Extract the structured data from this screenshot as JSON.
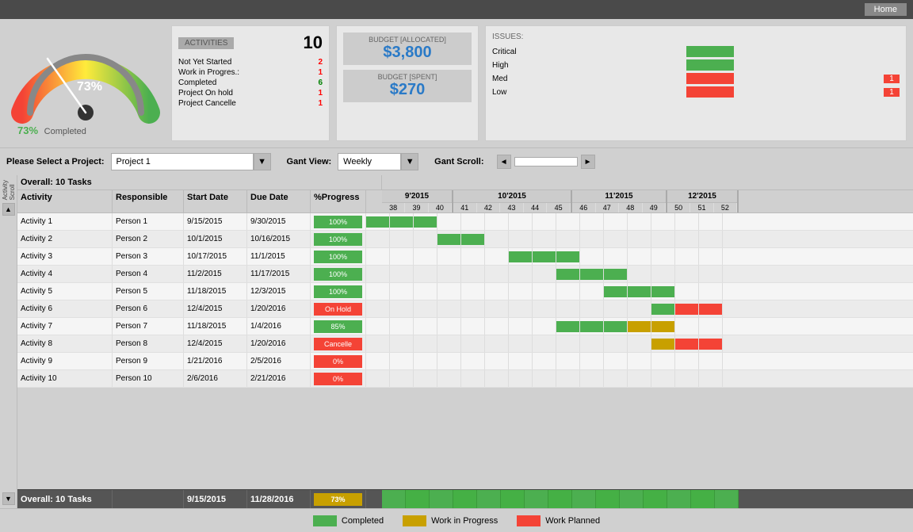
{
  "topbar": {
    "home_label": "Home"
  },
  "gauge": {
    "percent": 73,
    "label": "73%",
    "completed_text": "Completed"
  },
  "activities": {
    "title": "ACTIVITIES",
    "total": "10",
    "rows": [
      {
        "label": "Not Yet Started",
        "value": "2",
        "color": "red"
      },
      {
        "label": "Work in Progres.:",
        "value": "1",
        "color": "red"
      },
      {
        "label": "Completed",
        "value": "6",
        "color": "green"
      },
      {
        "label": "Project On hold",
        "value": "1",
        "color": "red"
      },
      {
        "label": "Project Cancelle",
        "value": "1",
        "color": "red"
      }
    ]
  },
  "budget": {
    "allocated_label": "BUDGET [ALLOCATED]",
    "allocated_value": "$3,800",
    "spent_label": "BUDGET [SPENT]",
    "spent_value": "$270"
  },
  "issues": {
    "title": "ISSUES:",
    "rows": [
      {
        "label": "Critical",
        "has_bar": true,
        "bar_color": "green",
        "count": ""
      },
      {
        "label": "High",
        "has_bar": true,
        "bar_color": "green",
        "count": ""
      },
      {
        "label": "Med",
        "has_bar": true,
        "bar_color": "red",
        "count": "1"
      },
      {
        "label": "Low",
        "has_bar": true,
        "bar_color": "red",
        "count": "1"
      }
    ]
  },
  "project_bar": {
    "label": "Please Select a Project:",
    "project_value": "Project 1",
    "gant_view_label": "Gant View:",
    "gant_view_value": "Weekly",
    "gant_scroll_label": "Gant Scroll:"
  },
  "gantt": {
    "overall_text": "Overall: 10 Tasks",
    "header": {
      "activity": "Activity",
      "responsible": "Responsible",
      "start_date": "Start Date",
      "due_date": "Due Date",
      "progress": "%Progress"
    },
    "months": [
      {
        "label": "9'2015",
        "weeks": [
          "38",
          "39",
          "40"
        ]
      },
      {
        "label": "10'2015",
        "weeks": [
          "41",
          "42",
          "43",
          "44",
          "45"
        ]
      },
      {
        "label": "11'2015",
        "weeks": [
          "46",
          "47",
          "48",
          "49"
        ]
      },
      {
        "label": "12'2015",
        "weeks": [
          "50",
          "51",
          "52"
        ]
      }
    ],
    "tasks": [
      {
        "activity": "Activity 1",
        "responsible": "Person 1",
        "start": "9/15/2015",
        "due": "9/30/2015",
        "progress": "100%",
        "prog_type": "100",
        "bars": [
          1,
          1,
          1,
          0,
          0,
          0,
          0,
          0,
          0,
          0,
          0,
          0,
          0,
          0,
          0
        ]
      },
      {
        "activity": "Activity 2",
        "responsible": "Person 2",
        "start": "10/1/2015",
        "due": "10/16/2015",
        "progress": "100%",
        "prog_type": "100",
        "bars": [
          0,
          0,
          0,
          1,
          1,
          0,
          0,
          0,
          0,
          0,
          0,
          0,
          0,
          0,
          0
        ]
      },
      {
        "activity": "Activity 3",
        "responsible": "Person 3",
        "start": "10/17/2015",
        "due": "11/1/2015",
        "progress": "100%",
        "prog_type": "100",
        "bars": [
          0,
          0,
          0,
          0,
          1,
          1,
          1,
          0,
          0,
          0,
          0,
          0,
          0,
          0,
          0
        ]
      },
      {
        "activity": "Activity 4",
        "responsible": "Person 4",
        "start": "11/2/2015",
        "due": "11/17/2015",
        "progress": "100%",
        "prog_type": "100",
        "bars": [
          0,
          0,
          0,
          0,
          0,
          0,
          1,
          1,
          1,
          0,
          0,
          0,
          0,
          0,
          0
        ]
      },
      {
        "activity": "Activity 5",
        "responsible": "Person 5",
        "start": "11/18/2015",
        "due": "12/3/2015",
        "progress": "100%",
        "prog_type": "100",
        "bars": [
          0,
          0,
          0,
          0,
          0,
          0,
          0,
          0,
          1,
          1,
          1,
          0,
          0,
          0,
          0
        ]
      },
      {
        "activity": "Activity 6",
        "responsible": "Person 6",
        "start": "12/4/2015",
        "due": "1/20/2016",
        "progress": "On Hold",
        "prog_type": "onhold",
        "bars": [
          0,
          0,
          0,
          0,
          0,
          0,
          0,
          0,
          0,
          0,
          1,
          2,
          2,
          2,
          2
        ]
      },
      {
        "activity": "Activity 7",
        "responsible": "Person 7",
        "start": "11/18/2015",
        "due": "1/4/2016",
        "progress": "85%",
        "prog_type": "85",
        "bars": [
          0,
          0,
          0,
          0,
          0,
          0,
          0,
          0,
          1,
          1,
          1,
          1,
          1,
          0,
          0
        ]
      },
      {
        "activity": "Activity 8",
        "responsible": "Person 8",
        "start": "12/4/2015",
        "due": "1/20/2016",
        "progress": "Cancelle",
        "prog_type": "cancelled",
        "bars": [
          0,
          0,
          0,
          0,
          0,
          0,
          0,
          0,
          0,
          0,
          1,
          3,
          3,
          3,
          3
        ]
      },
      {
        "activity": "Activity 9",
        "responsible": "Person 9",
        "start": "1/21/2016",
        "due": "2/5/2016",
        "progress": "0%",
        "prog_type": "0",
        "bars": [
          0,
          0,
          0,
          0,
          0,
          0,
          0,
          0,
          0,
          0,
          0,
          0,
          0,
          0,
          0
        ]
      },
      {
        "activity": "Activity 10",
        "responsible": "Person 10",
        "start": "2/6/2016",
        "due": "2/21/2016",
        "progress": "0%",
        "prog_type": "0",
        "bars": [
          0,
          0,
          0,
          0,
          0,
          0,
          0,
          0,
          0,
          0,
          0,
          0,
          0,
          0,
          0
        ]
      }
    ],
    "footer": {
      "activity": "Overall: 10 Tasks",
      "start": "9/15/2015",
      "due": "11/28/2016",
      "progress": "73%"
    }
  },
  "legend": {
    "completed": "Completed",
    "wip": "Work in Progress",
    "planned": "Work Planned"
  }
}
